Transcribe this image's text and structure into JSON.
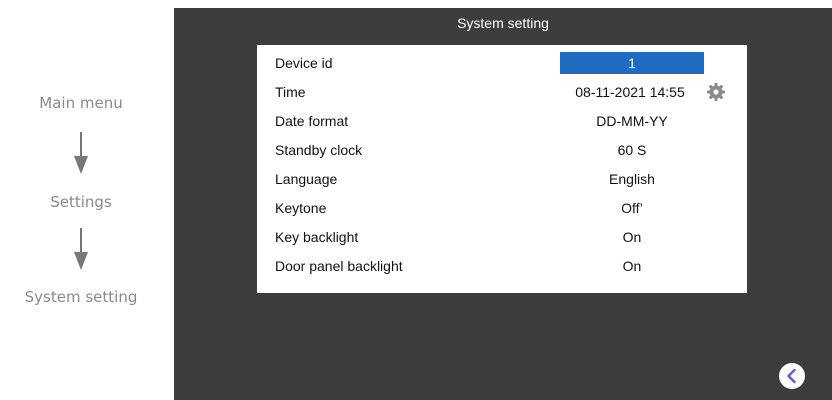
{
  "breadcrumb": {
    "items": [
      "Main menu",
      "Settings",
      "System setting"
    ],
    "arrow_icon": "down-arrow-icon"
  },
  "screen": {
    "title": "System setting",
    "background": "#3d3d3d",
    "accent": "#1f6bbf",
    "back_icon": "chevron-left-icon",
    "rows": [
      {
        "label": "Device id",
        "value": "1",
        "selected": true
      },
      {
        "label": "Time",
        "value": "08-11-2021 14:55",
        "icon": "gear-icon"
      },
      {
        "label": "Date format",
        "value": "DD-MM-YY"
      },
      {
        "label": "Standby clock",
        "value": "60 S"
      },
      {
        "label": "Language",
        "value": "English"
      },
      {
        "label": "Keytone",
        "value": "Off’"
      },
      {
        "label": "Key backlight",
        "value": "On"
      },
      {
        "label": "Door panel backlight",
        "value": "On"
      }
    ]
  }
}
